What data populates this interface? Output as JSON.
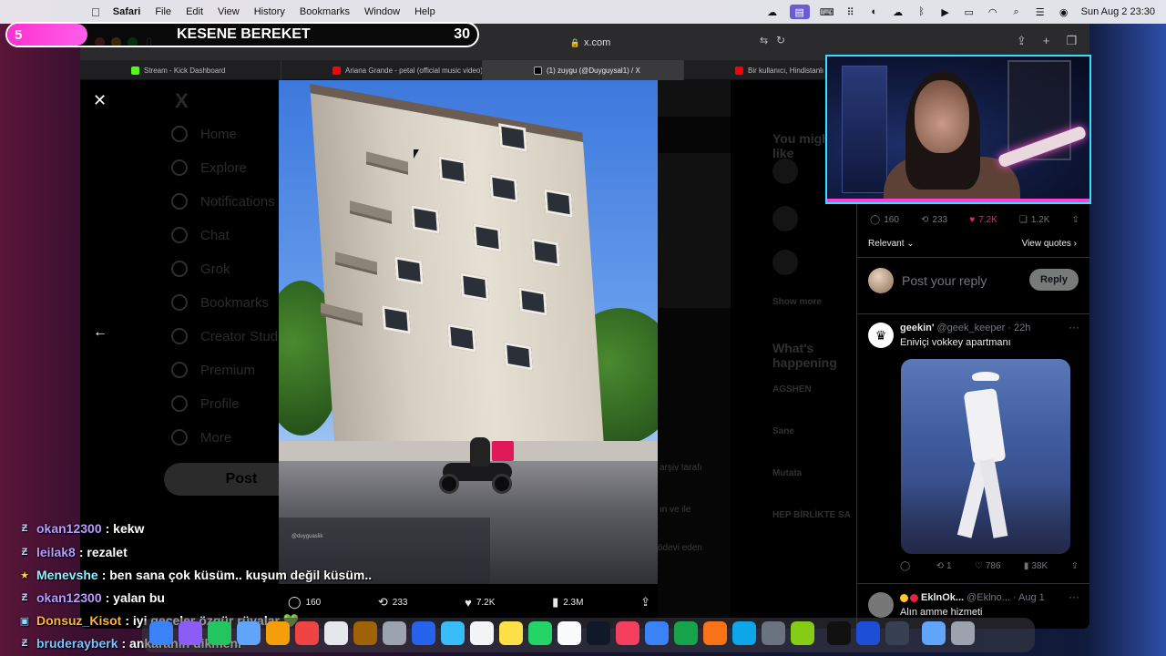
{
  "menubar": {
    "apple": "",
    "app": "Safari",
    "items": [
      "File",
      "Edit",
      "View",
      "History",
      "Bookmarks",
      "Window",
      "Help"
    ],
    "datetime": "Sun Aug 2  23:30"
  },
  "browser": {
    "url": "x.com",
    "tabs": [
      {
        "label": "Stream - Kick Dashboard",
        "color": "#53fc18"
      },
      {
        "label": "Ariana Grande - petal (official music video)...",
        "color": "#ff0000"
      },
      {
        "label": "(1) zuygu (@Duyguysal1) / X",
        "color": "#000000"
      },
      {
        "label": "Bir kullanıcı, Hindistanlı kayınvalid...",
        "color": "#ff0000"
      }
    ]
  },
  "x_nav": {
    "logo": "X",
    "items": [
      "Home",
      "Explore",
      "Notifications",
      "Chat",
      "Grok",
      "Bookmarks",
      "Creator Studio",
      "Premium",
      "Profile",
      "More"
    ],
    "post_label": "Post"
  },
  "bg_right": {
    "you_might_like": "You might like",
    "whats_happening": "What's happening",
    "trends": [
      "AGSHEN",
      "Sane",
      "Mutata",
      "HEP BİRLİKTE SA"
    ],
    "show_more": "Show more"
  },
  "bg_mid": {
    "texts": [
      "arşiv tarafı",
      "ın ve ile",
      "bir ödevi eden"
    ]
  },
  "photo": {
    "watermark": "@duyguaslik",
    "actions": {
      "replies": "160",
      "reposts": "233",
      "likes": "7.2K",
      "views": "2.3M"
    }
  },
  "panel": {
    "stats": {
      "replies": "160",
      "reposts": "233",
      "likes": "7.2K",
      "bookmarks": "1.2K"
    },
    "sort_label": "Relevant",
    "view_quotes": "View quotes",
    "reply_placeholder": "Post your reply",
    "reply_button": "Reply",
    "tweets": [
      {
        "name": "geekin'",
        "handle": "@geek_keeper",
        "time": "· 22h",
        "text": "Eniviçi vokkey apartmanı",
        "replies": "",
        "reposts": "1",
        "likes": "786",
        "views": "38K"
      },
      {
        "name": "EklnOk...",
        "handle": "@Eklno...",
        "time": "· Aug 1",
        "text": "Alın amme hizmeti",
        "dot_colors": [
          "#ffc928",
          "#e0243a"
        ]
      }
    ]
  },
  "overlay": {
    "counter": "5",
    "title": "KESENE BEREKET",
    "count": "30"
  },
  "chat": [
    {
      "user": "okan12300",
      "color": "#b99cff",
      "badge": "Ƶ",
      "text": ": kekw"
    },
    {
      "user": "leilak8",
      "color": "#b99cff",
      "badge": "Ƶ",
      "text": ": rezalet"
    },
    {
      "user": "Menevshe",
      "color": "#8ef0ff",
      "badge": "★",
      "text": ": ben sana çok küsüm.. kuşum değil küsüm.."
    },
    {
      "user": "okan12300",
      "color": "#b99cff",
      "badge": "Ƶ",
      "text": ": yalan bu"
    },
    {
      "user": "Donsuz_Kisot",
      "color": "#ffb238",
      "badge": "▣",
      "text": ": iyi geceler özgür rüyalar 💚"
    },
    {
      "user": "bruderayberk",
      "color": "#7ec2ff",
      "badge": "Ƶ",
      "text": ": ankaranın dikmeni"
    }
  ],
  "colors": {
    "accent_pink": "#f91880",
    "overlay_pink": "#ff2fd0",
    "webcam_border": "#33e0ff",
    "x_muted": "#71767b"
  }
}
